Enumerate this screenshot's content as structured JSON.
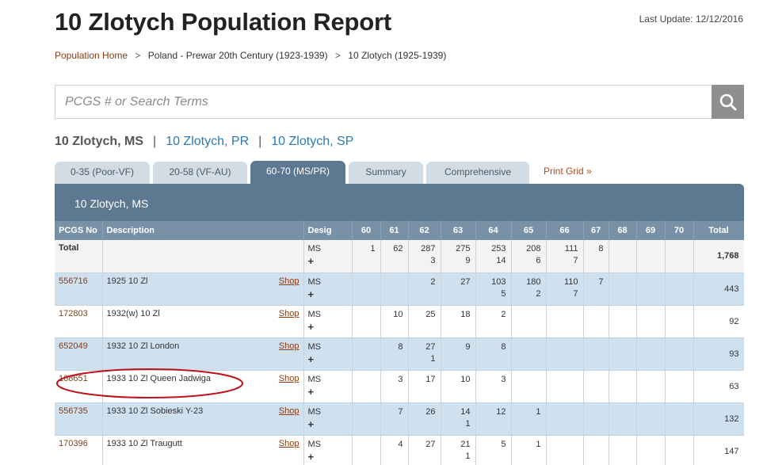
{
  "page": {
    "title": "10 Zlotych Population Report",
    "last_update": "Last Update: 12/12/2016"
  },
  "breadcrumb": [
    {
      "label": "Population Home"
    },
    {
      "label": "Poland - Prewar 20th Century (1923-1939)"
    },
    {
      "label": "10 Zlotych (1925-1939)"
    }
  ],
  "breadcrumb_sep": ">",
  "search": {
    "placeholder": "PCGS # or Search Terms",
    "icon": "search-icon"
  },
  "grade_links": {
    "current": "10 Zlotych, MS",
    "separator": "|",
    "links": [
      "10 Zlotych, PR",
      "10 Zlotych, SP"
    ]
  },
  "tabs": [
    {
      "label": "0-35 (Poor-VF)",
      "active": false
    },
    {
      "label": "20-58 (VF-AU)",
      "active": false
    },
    {
      "label": "60-70 (MS/PR)",
      "active": true
    },
    {
      "label": "Summary",
      "active": false
    },
    {
      "label": "Comprehensive",
      "active": false
    }
  ],
  "print_grid": "Print Grid »",
  "panel": {
    "title": "10 Zlotych, MS"
  },
  "colors": {
    "header": "#5d7891",
    "subheader": "#7891a7",
    "alt_row": "#cfe0ef",
    "link": "#8a3b12",
    "annotation": "#c0121a"
  },
  "table": {
    "headers": {
      "pcgs": "PCGS No",
      "desc": "Description",
      "desig": "Desig",
      "grades": [
        "60",
        "61",
        "62",
        "63",
        "64",
        "65",
        "66",
        "67",
        "68",
        "69",
        "70"
      ],
      "total": "Total"
    },
    "shop_label": "Shop",
    "plus_label": "+",
    "total_row": {
      "label": "Total",
      "desig": "MS",
      "grades": [
        [
          "1",
          ""
        ],
        [
          "62",
          ""
        ],
        [
          "287",
          "3"
        ],
        [
          "275",
          "9"
        ],
        [
          "253",
          "14"
        ],
        [
          "208",
          "6"
        ],
        [
          "111",
          "7"
        ],
        [
          "8",
          ""
        ],
        [
          "",
          ""
        ],
        [
          "",
          ""
        ],
        [
          "",
          ""
        ]
      ],
      "total": "1,768"
    },
    "rows": [
      {
        "pcgs": "556716",
        "desc": "1925 10 Zl",
        "desig": "MS",
        "grades": [
          [
            "",
            ""
          ],
          [
            "",
            ""
          ],
          [
            "2",
            ""
          ],
          [
            "27",
            ""
          ],
          [
            "103",
            "5"
          ],
          [
            "180",
            "2"
          ],
          [
            "110",
            "7"
          ],
          [
            "7",
            ""
          ],
          [
            "",
            ""
          ],
          [
            "",
            ""
          ],
          [
            "",
            ""
          ]
        ],
        "total": "443"
      },
      {
        "pcgs": "172803",
        "desc": "1932(w) 10 Zl",
        "desig": "MS",
        "grades": [
          [
            "",
            ""
          ],
          [
            "10",
            ""
          ],
          [
            "25",
            ""
          ],
          [
            "18",
            ""
          ],
          [
            "2",
            ""
          ],
          [
            "",
            ""
          ],
          [
            "",
            ""
          ],
          [
            "",
            ""
          ],
          [
            "",
            ""
          ],
          [
            "",
            ""
          ],
          [
            "",
            ""
          ]
        ],
        "total": "92"
      },
      {
        "pcgs": "652049",
        "desc": "1932 10 Zl London",
        "desig": "MS",
        "grades": [
          [
            "",
            ""
          ],
          [
            "8",
            ""
          ],
          [
            "27",
            "1"
          ],
          [
            "9",
            ""
          ],
          [
            "8",
            ""
          ],
          [
            "",
            ""
          ],
          [
            "",
            ""
          ],
          [
            "",
            ""
          ],
          [
            "",
            ""
          ],
          [
            "",
            ""
          ],
          [
            "",
            ""
          ]
        ],
        "total": "93"
      },
      {
        "pcgs": "168651",
        "desc": "1933 10 Zl Queen Jadwiga",
        "desig": "MS",
        "grades": [
          [
            "",
            ""
          ],
          [
            "3",
            ""
          ],
          [
            "17",
            ""
          ],
          [
            "10",
            ""
          ],
          [
            "3",
            ""
          ],
          [
            "",
            ""
          ],
          [
            "",
            ""
          ],
          [
            "",
            ""
          ],
          [
            "",
            ""
          ],
          [
            "",
            ""
          ],
          [
            "",
            ""
          ]
        ],
        "total": "63"
      },
      {
        "pcgs": "556735",
        "desc": "1933 10 Zl Sobieski Y-23",
        "desig": "MS",
        "grades": [
          [
            "",
            ""
          ],
          [
            "7",
            ""
          ],
          [
            "26",
            ""
          ],
          [
            "14",
            "1"
          ],
          [
            "12",
            ""
          ],
          [
            "1",
            ""
          ],
          [
            "",
            ""
          ],
          [
            "",
            ""
          ],
          [
            "",
            ""
          ],
          [
            "",
            ""
          ],
          [
            "",
            ""
          ]
        ],
        "total": "132"
      },
      {
        "pcgs": "170396",
        "desc": "1933 10 Zl Traugutt",
        "desig": "MS",
        "grades": [
          [
            "",
            ""
          ],
          [
            "4",
            ""
          ],
          [
            "27",
            ""
          ],
          [
            "21",
            "1"
          ],
          [
            "5",
            ""
          ],
          [
            "1",
            ""
          ],
          [
            "",
            ""
          ],
          [
            "",
            ""
          ],
          [
            "",
            ""
          ],
          [
            "",
            ""
          ],
          [
            "",
            ""
          ]
        ],
        "total": "147"
      }
    ]
  }
}
